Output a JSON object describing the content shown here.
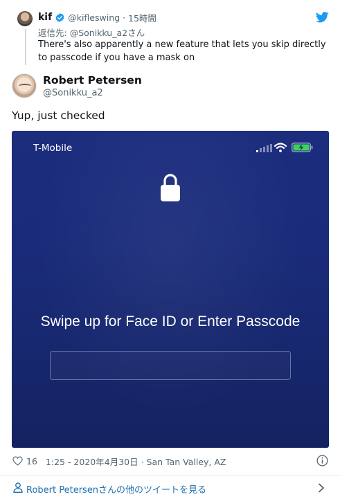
{
  "parent_tweet": {
    "author_name": "kif",
    "verified_icon": "verified-badge-icon",
    "handle": "@kifleswing",
    "separator": "·",
    "time": "15時間",
    "reply_to_label": "返信先:",
    "reply_to_handle": "@Sonikku_a2",
    "reply_to_suffix": "さん",
    "text": "There's also apparently a new feature that lets you skip directly to passcode if you have a mask on"
  },
  "tweet": {
    "author_name": "Robert Petersen",
    "handle": "@Sonikku_a2",
    "text": "Yup, just checked"
  },
  "screenshot": {
    "carrier": "T-Mobile",
    "lock_icon": "padlock-icon",
    "prompt": "Swipe up for Face ID or Enter Passcode"
  },
  "meta": {
    "likes": "16",
    "timestamp": "1:25 - 2020年4月30日 · San Tan Valley, AZ"
  },
  "footer": {
    "link_text": "Robert Petersenさんの他のツイートを見る"
  },
  "colors": {
    "twitter_blue": "#1d9bf0",
    "link": "#1b6fb0",
    "muted": "#536471",
    "screen_bg": "#1a2b7a"
  }
}
